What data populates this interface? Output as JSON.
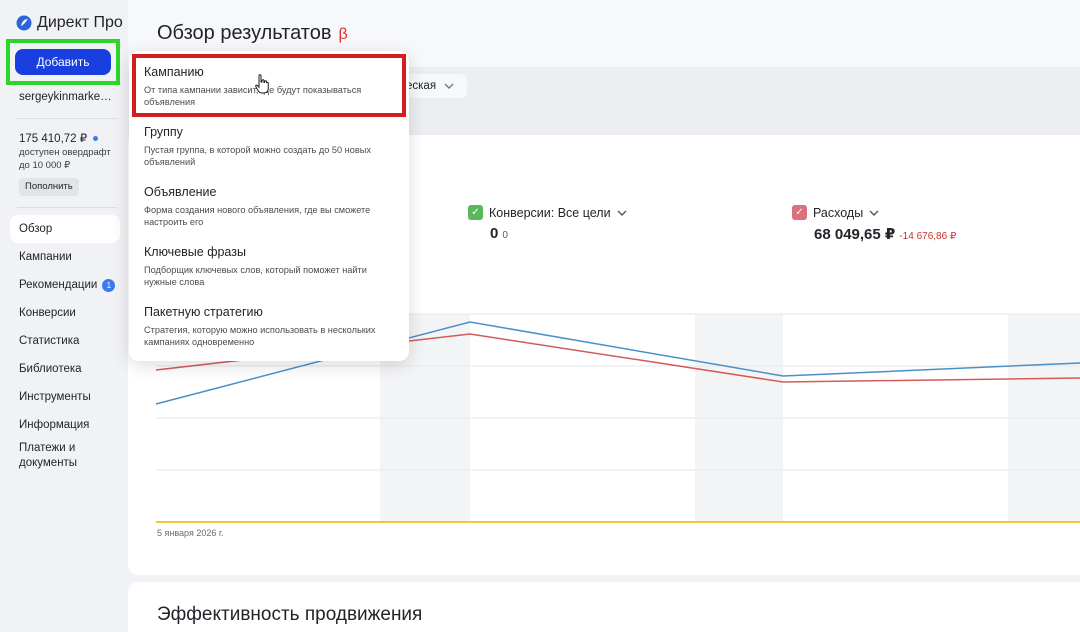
{
  "app": {
    "logo_text": "Директ Про",
    "add_button": "Добавить",
    "username": "sergeykinmarke…"
  },
  "account": {
    "balance": "175 410,72 ₽",
    "overdraft_text": "доступен овердрафт до 10 000 ₽",
    "topup_button": "Пополнить"
  },
  "sidebar": {
    "items": [
      {
        "label": "Обзор",
        "active": true
      },
      {
        "label": "Кампании"
      },
      {
        "label": "Рекомендации",
        "badge": "1"
      },
      {
        "label": "Конверсии"
      },
      {
        "label": "Статистика"
      },
      {
        "label": "Библиотека"
      },
      {
        "label": "Инструменты"
      },
      {
        "label": "Информация"
      },
      {
        "label": "Платежи и документы"
      }
    ]
  },
  "header": {
    "title": "Обзор результатов",
    "beta": "β"
  },
  "filter": {
    "select_value": "ческая"
  },
  "metrics": {
    "conversions": {
      "label": "Конверсии: Все цели",
      "value": "0",
      "sub": "0",
      "color": "#5cb85c"
    },
    "expenses": {
      "label": "Расходы",
      "value": "68 049,65 ₽",
      "delta": "-14 676,86 ₽",
      "color": "#d9727a"
    }
  },
  "chart": {
    "date_label": "5 января 2026 г.",
    "series_colors": {
      "blue": "#4a90c8",
      "red": "#d45a5a",
      "baseline": "#f0b400"
    }
  },
  "section": {
    "title": "Эффективность продвижения"
  },
  "menu": {
    "items": [
      {
        "title": "Кампанию",
        "desc": "От типа кампании зависит, где будут показываться объявления"
      },
      {
        "title": "Группу",
        "desc": "Пустая группа, в которой можно создать до 50 новых объявлений"
      },
      {
        "title": "Объявление",
        "desc": "Форма создания нового объявления, где вы сможете настроить его"
      },
      {
        "title": "Ключевые фразы",
        "desc": "Подборщик ключевых слов, который поможет найти нужные слова"
      },
      {
        "title": "Пакетную стратегию",
        "desc": "Стратегия, которую можно использовать в нескольких кампаниях одновременно"
      }
    ]
  }
}
